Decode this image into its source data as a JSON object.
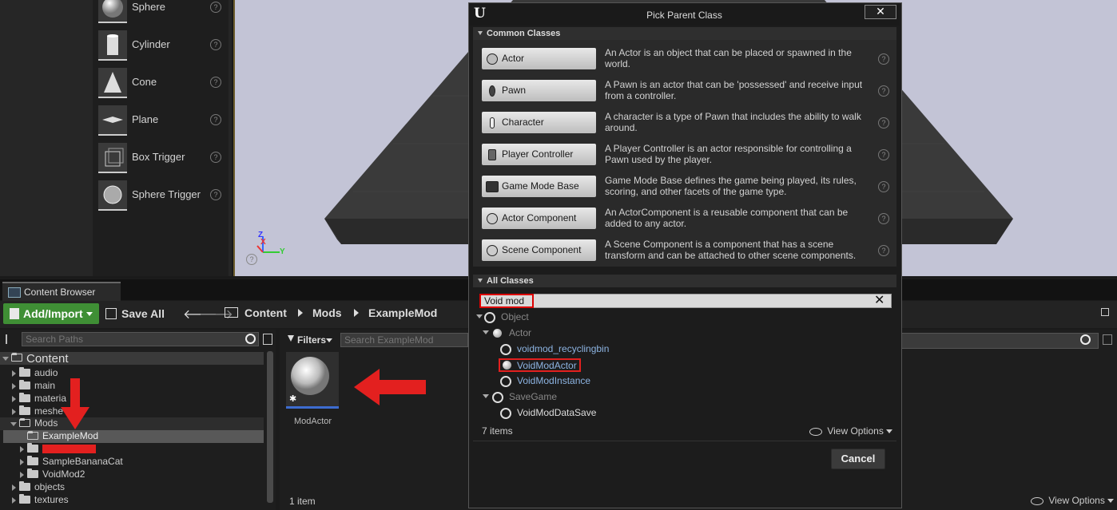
{
  "place_actors": {
    "items": [
      {
        "label": "Sphere",
        "icon": "sphere-icon"
      },
      {
        "label": "Cylinder",
        "icon": "cylinder-icon"
      },
      {
        "label": "Cone",
        "icon": "cone-icon"
      },
      {
        "label": "Plane",
        "icon": "plane-icon"
      },
      {
        "label": "Box Trigger",
        "icon": "box-trigger-icon"
      },
      {
        "label": "Sphere Trigger",
        "icon": "sphere-trigger-icon"
      }
    ],
    "help_glyph": "?"
  },
  "viewport": {
    "axis_x": "X",
    "axis_y": "Y",
    "axis_z": "Z",
    "background_color": "#c3c4d6"
  },
  "content_browser": {
    "tab_label": "Content Browser",
    "toolbar": {
      "add_import_label": "Add/Import",
      "save_all_label": "Save All"
    },
    "breadcrumb": [
      "Content",
      "Mods",
      "ExampleMod"
    ],
    "search_paths_placeholder": "Search Paths",
    "filters_label": "Filters",
    "search_assets_placeholder": "Search ExampleMod",
    "tree": [
      {
        "label": "Content",
        "level": 0,
        "expanded": true
      },
      {
        "label": "audio",
        "level": 1
      },
      {
        "label": "main",
        "level": 1
      },
      {
        "label": "materia",
        "level": 1
      },
      {
        "label": "meshe",
        "level": 1
      },
      {
        "label": "Mods",
        "level": 1,
        "expanded": true
      },
      {
        "label": "ExampleMod",
        "level": 2,
        "selected": true
      },
      {
        "label": "",
        "level": 2,
        "redacted": true
      },
      {
        "label": "SampleBananaCat",
        "level": 2
      },
      {
        "label": "VoidMod2",
        "level": 2
      },
      {
        "label": "objects",
        "level": 1
      },
      {
        "label": "textures",
        "level": 1
      }
    ],
    "asset": {
      "name": "ModActor"
    },
    "item_count": "1 item",
    "view_options_label": "View Options",
    "accent_color": "#3f8f35"
  },
  "dialog": {
    "title": "Pick Parent Class",
    "close_glyph": "✕",
    "common_header": "Common Classes",
    "common_classes": [
      {
        "label": "Actor",
        "desc": "An Actor is an object that can be placed or spawned in the world.",
        "icon": "actor-icon"
      },
      {
        "label": "Pawn",
        "desc": "A Pawn is an actor that can be 'possessed' and receive input from a controller.",
        "icon": "pawn-icon"
      },
      {
        "label": "Character",
        "desc": "A character is a type of Pawn that includes the ability to walk around.",
        "icon": "character-icon"
      },
      {
        "label": "Player Controller",
        "desc": "A Player Controller is an actor responsible for controlling a Pawn used by the player.",
        "icon": "player-controller-icon"
      },
      {
        "label": "Game Mode Base",
        "desc": "Game Mode Base defines the game being played, its rules, scoring, and other facets of the game type.",
        "icon": "game-mode-icon"
      },
      {
        "label": "Actor Component",
        "desc": "An ActorComponent is a reusable component that can be added to any actor.",
        "icon": "actor-component-icon"
      },
      {
        "label": "Scene Component",
        "desc": "A Scene Component is a component that has a scene transform and can be attached to other scene components.",
        "icon": "scene-component-icon"
      }
    ],
    "all_header": "All Classes",
    "search_value": "Void mod",
    "class_tree": [
      {
        "label": "Object",
        "level": 0,
        "dim": true,
        "icon": "ring"
      },
      {
        "label": "Actor",
        "level": 1,
        "dim": true,
        "icon": "ball"
      },
      {
        "label": "voidmod_recyclingbin",
        "level": 2,
        "blue": true,
        "icon": "ring"
      },
      {
        "label": "VoidModActor",
        "level": 2,
        "blue": true,
        "icon": "ball",
        "highlight": true
      },
      {
        "label": "VoidModInstance",
        "level": 2,
        "blue": true,
        "icon": "ring"
      },
      {
        "label": "SaveGame",
        "level": 1,
        "dim": true,
        "icon": "ring"
      },
      {
        "label": "VoidModDataSave",
        "level": 2,
        "icon": "ring"
      }
    ],
    "item_count": "7 items",
    "view_options_label": "View Options",
    "cancel_label": "Cancel",
    "annotation_color": "#e3201f",
    "link_color": "#8db4e2"
  }
}
